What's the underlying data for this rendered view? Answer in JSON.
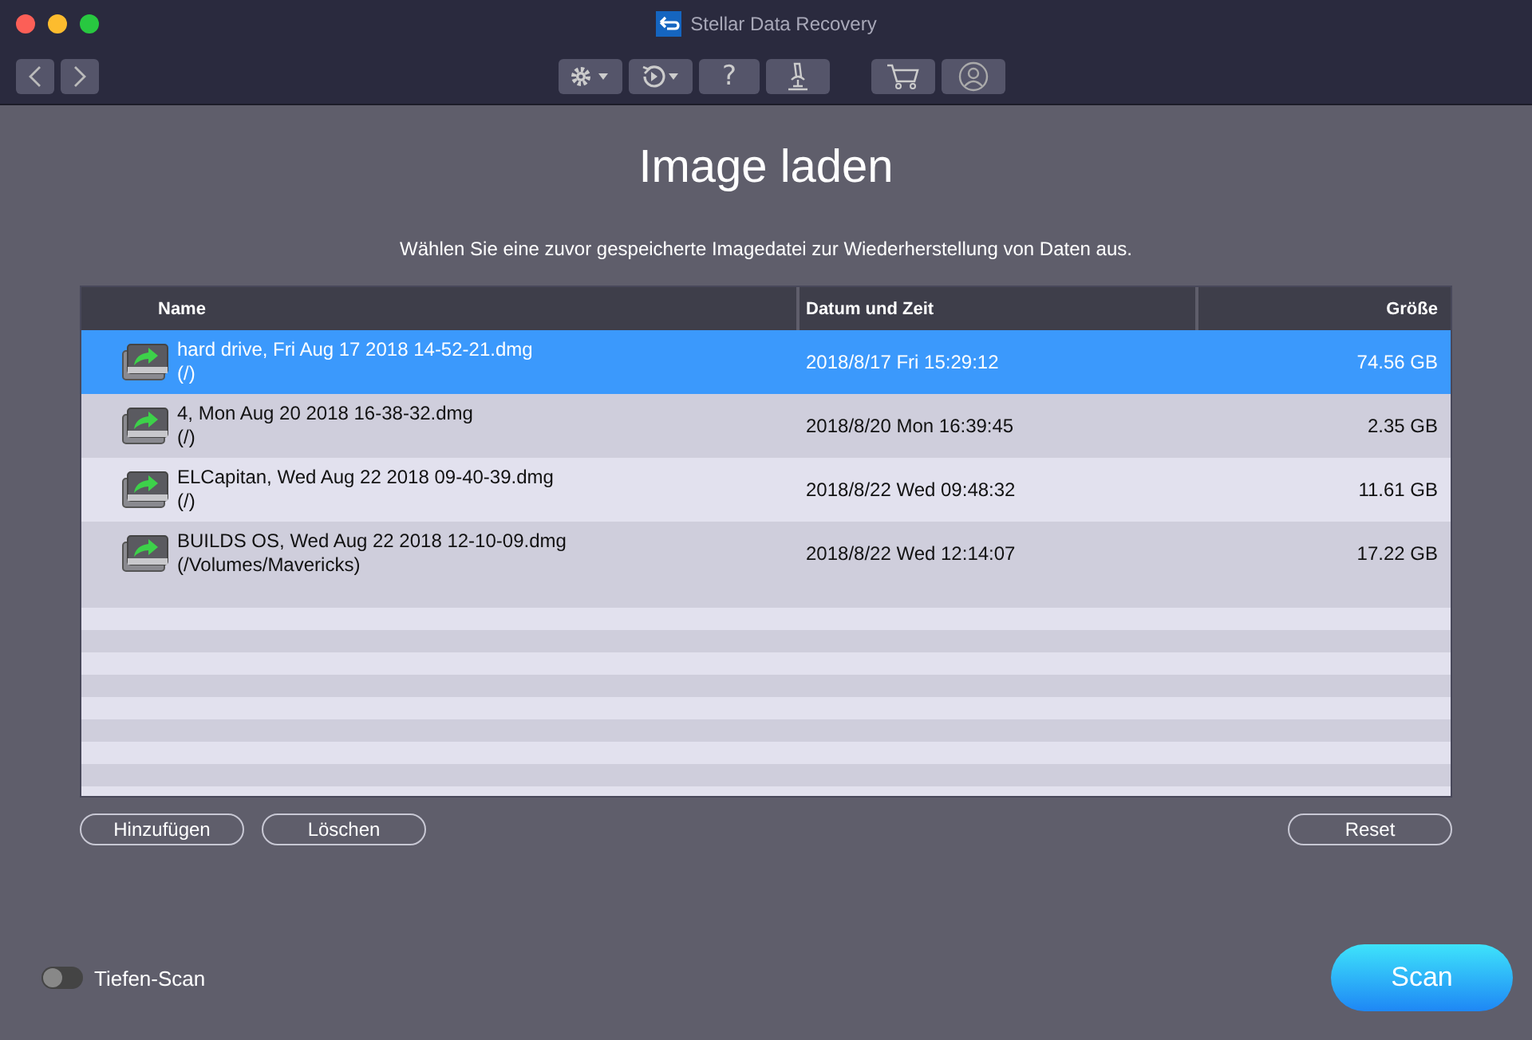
{
  "window": {
    "title": "Stellar Data Recovery"
  },
  "toolbar": {
    "help_label": "?"
  },
  "heading": "Image laden",
  "subtitle": "Wählen Sie eine zuvor gespeicherte Imagedatei zur Wiederherstellung von Daten aus.",
  "table": {
    "columns": [
      "Name",
      "Datum und Zeit",
      "Größe"
    ],
    "rows": [
      {
        "name": "hard drive, Fri Aug 17 2018 14-52-21.dmg",
        "path": "(/)",
        "date": "2018/8/17 Fri 15:29:12",
        "size": "74.56 GB",
        "selected": true
      },
      {
        "name": "4, Mon Aug 20 2018 16-38-32.dmg",
        "path": "(/)",
        "date": "2018/8/20 Mon 16:39:45",
        "size": "2.35 GB",
        "selected": false
      },
      {
        "name": "ELCapitan, Wed Aug 22 2018 09-40-39.dmg",
        "path": "(/)",
        "date": "2018/8/22 Wed 09:48:32",
        "size": "11.61 GB",
        "selected": false
      },
      {
        "name": "BUILDS OS, Wed Aug 22 2018 12-10-09.dmg",
        "path": "(/Volumes/Mavericks)",
        "date": "2018/8/22 Wed 12:14:07",
        "size": "17.22 GB",
        "selected": false
      }
    ]
  },
  "buttons": {
    "add": "Hinzufügen",
    "delete": "Löschen",
    "reset": "Reset"
  },
  "deep_scan": {
    "label": "Tiefen-Scan",
    "on": false
  },
  "scan_button": "Scan"
}
